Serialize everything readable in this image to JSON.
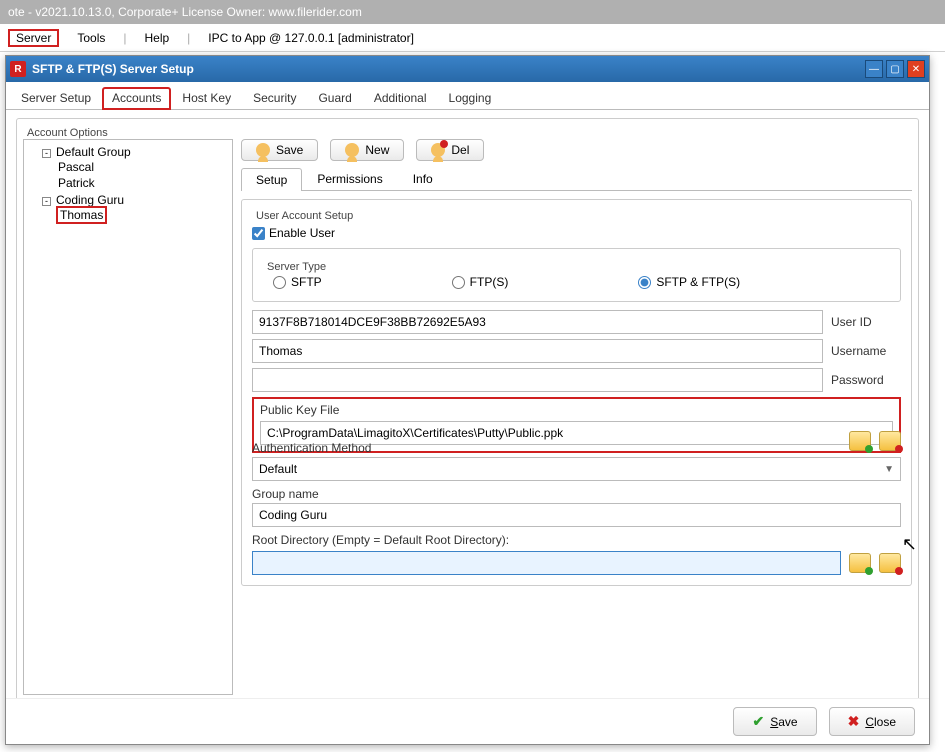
{
  "outer_title": "ote - v2021.10.13.0, Corporate+ License Owner: www.filerider.com",
  "menu": {
    "server": "Server",
    "tools": "Tools",
    "help": "Help",
    "ipc": "IPC to App @ 127.0.0.1 [administrator]"
  },
  "dialog": {
    "title": "SFTP & FTP(S) Server Setup",
    "main_tabs": [
      "Server Setup",
      "Accounts",
      "Host Key",
      "Security",
      "Guard",
      "Additional",
      "Logging"
    ],
    "active_main_tab": "Accounts",
    "fieldset_title": "Account Options",
    "tree": {
      "groups": [
        {
          "name": "Default Group",
          "users": [
            "Pascal",
            "Patrick"
          ]
        },
        {
          "name": "Coding Guru",
          "users": [
            "Thomas"
          ]
        }
      ],
      "selected_user": "Thomas"
    },
    "toolbar": {
      "save": "Save",
      "new": "New",
      "del": "Del"
    },
    "sub_tabs": [
      "Setup",
      "Permissions",
      "Info"
    ],
    "active_sub_tab": "Setup",
    "setup": {
      "fieldset_title": "User Account Setup",
      "enable_user_label": "Enable User",
      "enable_user_checked": true,
      "server_type_legend": "Server Type",
      "server_types": [
        "SFTP",
        "FTP(S)",
        "SFTP & FTP(S)"
      ],
      "server_type_selected": "SFTP & FTP(S)",
      "user_id": "9137F8B718014DCE9F38BB72692E5A93",
      "user_id_label": "User ID",
      "username": "Thomas",
      "username_label": "Username",
      "password": "",
      "password_label": "Password",
      "public_key_label": "Public Key File",
      "public_key_file": "C:\\ProgramData\\LimagitoX\\Certificates\\Putty\\Public.ppk",
      "auth_method_label": "Authentication Method",
      "auth_method": "Default",
      "group_name_label": "Group name",
      "group_name": "Coding Guru",
      "root_dir_label": "Root Directory (Empty = Default Root Directory):",
      "root_dir": ""
    },
    "footer": {
      "save": "Save",
      "close": "Close"
    }
  }
}
